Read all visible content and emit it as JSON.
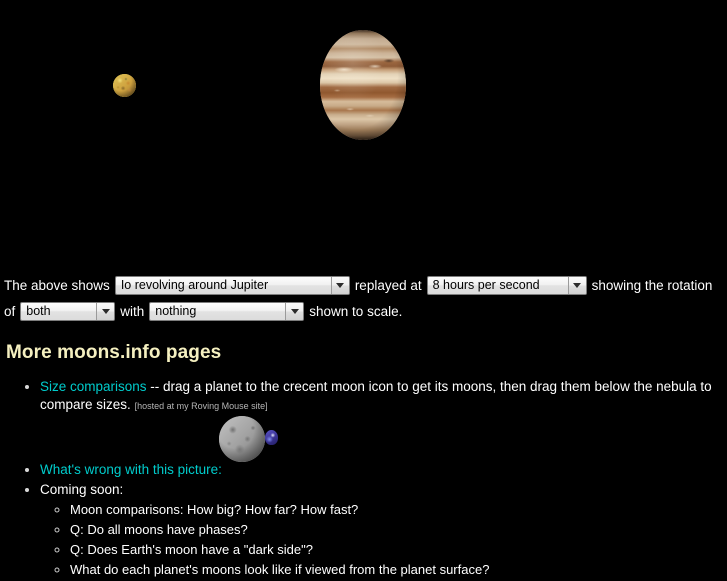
{
  "stage": {
    "objects": [
      {
        "name": "Jupiter",
        "role": "primary-planet"
      },
      {
        "name": "Io",
        "role": "revolving-moon"
      }
    ]
  },
  "controls": {
    "lead_text": "The above shows",
    "object_select": {
      "value": "Io revolving around Jupiter",
      "options": [
        "Io revolving around Jupiter"
      ]
    },
    "mid_text": "replayed at",
    "speed_select": {
      "value": "8 hours per second",
      "options": [
        "8 hours per second"
      ]
    },
    "tail_text": "showing the rotation",
    "of_text": "of",
    "rotation_select": {
      "value": "both",
      "options": [
        "both"
      ]
    },
    "with_text": "with",
    "scale_select": {
      "value": "nothing",
      "options": [
        "nothing"
      ]
    },
    "end_text": "shown to scale.",
    "dropdown_icon": "chevron-down-icon"
  },
  "content": {
    "heading": "More moons.info pages",
    "items": [
      {
        "link_text": "Size comparisons",
        "body_text": " -- drag a planet to the crecent moon icon to get its moons, then drag them below the nebula to compare sizes.",
        "note": "[hosted at my Roving Mouse site]"
      },
      {
        "link_text": "What's wrong with this picture:",
        "body_text": "",
        "note": ""
      }
    ],
    "coming_soon_label": "Coming soon:",
    "coming_soon_items": [
      "Moon comparisons: How big? How far? How fast?",
      "Q: Do all moons have phases?",
      "Q: Does Earth's moon have a \"dark side\"?",
      "What do each planet's moons look like if viewed from the planet surface?"
    ]
  },
  "colors": {
    "background": "#000000",
    "heading": "#f5f0c0",
    "link": "#00cccc",
    "text": "#ffffff",
    "note": "#b5b5b5"
  }
}
